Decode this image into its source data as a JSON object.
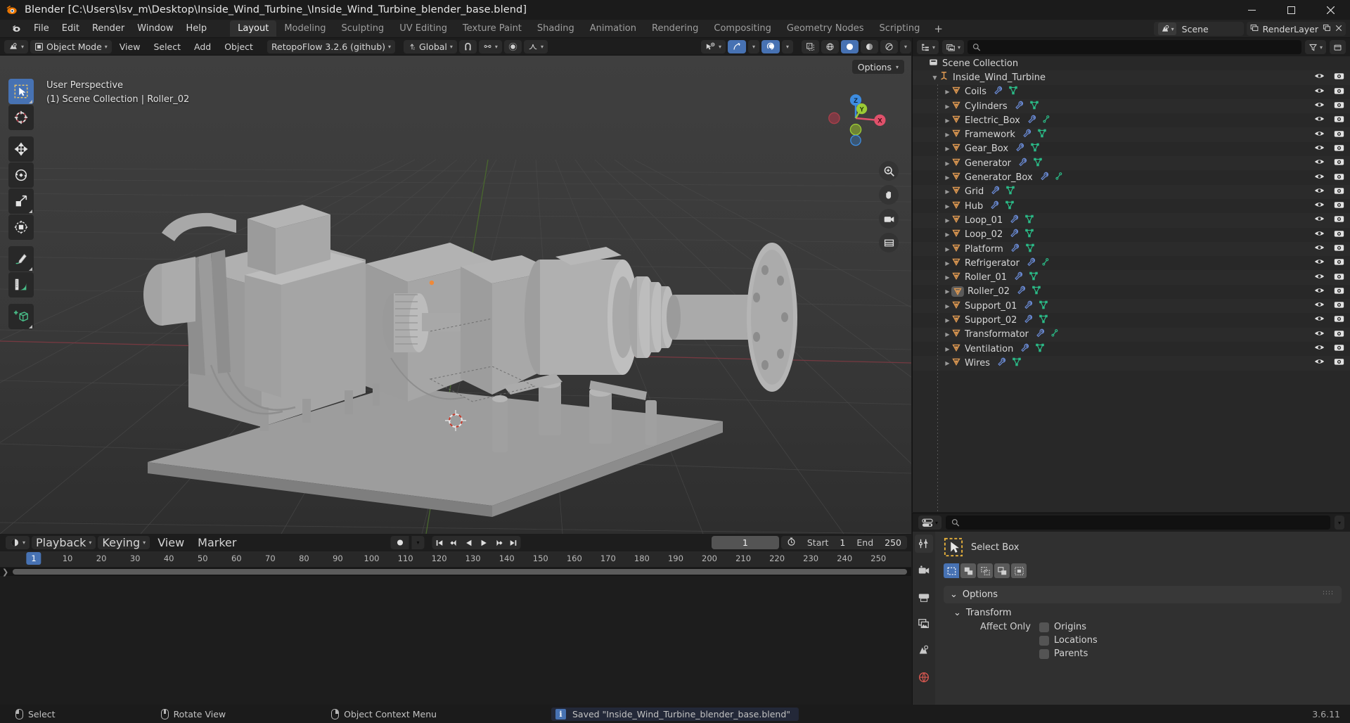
{
  "window": {
    "title": "Blender [C:\\Users\\lsv_m\\Desktop\\Inside_Wind_Turbine_\\Inside_Wind_Turbine_blender_base.blend]",
    "minimize": "–",
    "maximize": "❐",
    "close": "✕"
  },
  "topbar": {
    "menus": [
      "File",
      "Edit",
      "Render",
      "Window",
      "Help"
    ],
    "workspaces": [
      {
        "label": "Layout",
        "active": true
      },
      {
        "label": "Modeling",
        "active": false
      },
      {
        "label": "Sculpting",
        "active": false
      },
      {
        "label": "UV Editing",
        "active": false
      },
      {
        "label": "Texture Paint",
        "active": false
      },
      {
        "label": "Shading",
        "active": false
      },
      {
        "label": "Animation",
        "active": false
      },
      {
        "label": "Rendering",
        "active": false
      },
      {
        "label": "Compositing",
        "active": false
      },
      {
        "label": "Geometry Nodes",
        "active": false
      },
      {
        "label": "Scripting",
        "active": false
      }
    ],
    "add_workspace": "+",
    "scene_name": "Scene",
    "view_layer_name": "RenderLayer"
  },
  "viewport_header": {
    "mode": "Object Mode",
    "menus": [
      "View",
      "Select",
      "Add",
      "Object"
    ],
    "addon": "RetopoFlow 3.2.6 (github)",
    "transform_orientation": "Global"
  },
  "viewport": {
    "perspective": "User Perspective",
    "scene_info": "(1) Scene Collection | Roller_02",
    "options_label": "Options",
    "gizmo_axes": [
      "Z",
      "Y",
      "X"
    ],
    "tools": [
      {
        "name": "tweak-tool",
        "label": "Tweak",
        "active": true
      },
      {
        "name": "cursor-tool",
        "label": "Cursor",
        "active": false
      },
      {
        "name": "move-tool",
        "label": "Move",
        "active": false
      },
      {
        "name": "rotate-tool",
        "label": "Rotate",
        "active": false
      },
      {
        "name": "scale-tool",
        "label": "Scale",
        "active": false
      },
      {
        "name": "transform-tool",
        "label": "Transform",
        "active": false
      },
      {
        "name": "annotate-tool",
        "label": "Annotate",
        "active": false
      },
      {
        "name": "measure-tool",
        "label": "Measure",
        "active": false
      },
      {
        "name": "add-cube-tool",
        "label": "Add Cube",
        "active": false
      }
    ]
  },
  "outliner": {
    "search_placeholder": "",
    "root": "Scene Collection",
    "collection": "Inside_Wind_Turbine",
    "items": [
      {
        "name": "Coils",
        "modifier": true,
        "mesh": true,
        "selected": false
      },
      {
        "name": "Cylinders",
        "modifier": true,
        "mesh": true,
        "selected": false
      },
      {
        "name": "Electric_Box",
        "modifier": true,
        "mesh": false,
        "selected": false
      },
      {
        "name": "Framework",
        "modifier": true,
        "mesh": true,
        "selected": false
      },
      {
        "name": "Gear_Box",
        "modifier": true,
        "mesh": true,
        "selected": false
      },
      {
        "name": "Generator",
        "modifier": true,
        "mesh": true,
        "selected": false
      },
      {
        "name": "Generator_Box",
        "modifier": true,
        "mesh": false,
        "selected": false
      },
      {
        "name": "Grid",
        "modifier": true,
        "mesh": true,
        "selected": false
      },
      {
        "name": "Hub",
        "modifier": true,
        "mesh": true,
        "selected": false
      },
      {
        "name": "Loop_01",
        "modifier": true,
        "mesh": true,
        "selected": false
      },
      {
        "name": "Loop_02",
        "modifier": true,
        "mesh": true,
        "selected": false
      },
      {
        "name": "Platform",
        "modifier": true,
        "mesh": true,
        "selected": false
      },
      {
        "name": "Refrigerator",
        "modifier": true,
        "mesh": false,
        "selected": false
      },
      {
        "name": "Roller_01",
        "modifier": true,
        "mesh": true,
        "selected": false
      },
      {
        "name": "Roller_02",
        "modifier": true,
        "mesh": true,
        "selected": true
      },
      {
        "name": "Support_01",
        "modifier": true,
        "mesh": true,
        "selected": false
      },
      {
        "name": "Support_02",
        "modifier": true,
        "mesh": true,
        "selected": false
      },
      {
        "name": "Transformator",
        "modifier": true,
        "mesh": false,
        "selected": false
      },
      {
        "name": "Ventilation",
        "modifier": true,
        "mesh": true,
        "selected": false
      },
      {
        "name": "Wires",
        "modifier": true,
        "mesh": true,
        "selected": false
      }
    ]
  },
  "properties": {
    "search_placeholder": "",
    "active_tool": "Select Box",
    "panels": {
      "options": "Options",
      "transform": "Transform",
      "affect_only_label": "Affect Only",
      "checkboxes": [
        {
          "label": "Origins",
          "checked": false
        },
        {
          "label": "Locations",
          "checked": false
        },
        {
          "label": "Parents",
          "checked": false
        }
      ]
    }
  },
  "timeline": {
    "menus": [
      "Playback",
      "Keying",
      "View",
      "Marker"
    ],
    "current_frame": "1",
    "start_label": "Start",
    "start_value": "1",
    "end_label": "End",
    "end_value": "250",
    "ticks": [
      10,
      20,
      30,
      40,
      50,
      60,
      70,
      80,
      90,
      100,
      110,
      120,
      130,
      140,
      150,
      160,
      170,
      180,
      190,
      200,
      210,
      220,
      230,
      240,
      250
    ],
    "playhead_frame": "1"
  },
  "statusbar": {
    "mouse_hints": [
      {
        "button": "lmb",
        "label": "Select"
      },
      {
        "button": "mmb",
        "label": "Rotate View"
      },
      {
        "button": "rmb",
        "label": "Object Context Menu"
      }
    ],
    "report": "Saved \"Inside_Wind_Turbine_blender_base.blend\"",
    "report_icon": "i",
    "version": "3.6.11"
  },
  "colors": {
    "accent_blue": "#4772b3",
    "collection_orange": "#e09a52",
    "mesh_green": "#2bbf8a",
    "modifier_blue": "#6a8bd6",
    "axis_x": "#e0516b",
    "axis_y": "#9bcb35",
    "axis_z": "#3d8ce0"
  }
}
